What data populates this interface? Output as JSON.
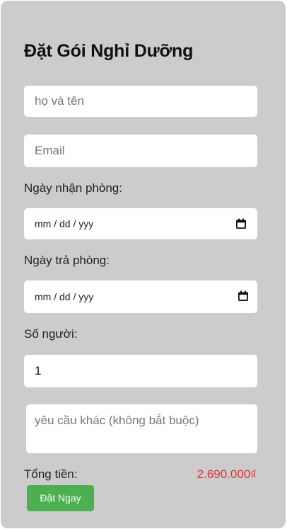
{
  "form": {
    "title": "Đặt Gói Nghỉ Dưỡng",
    "name_placeholder": "họ và tên",
    "email_placeholder": "Email",
    "checkin_label": "Ngày nhận phòng:",
    "checkin_placeholder": "mm / dd / yyy",
    "checkout_label": "Ngày trả phòng:",
    "checkout_placeholder": "mm / dd / yyy",
    "guests_label": "Số người:",
    "guests_value": "1",
    "notes_placeholder": "yêu cầu khác (không bắt buộc)",
    "total_label": "Tổng tiền:",
    "total_value": "2.690.000₫",
    "submit_label": "Đặt Ngay"
  },
  "colors": {
    "card_background": "#cccccc",
    "total_value": "#e23232",
    "submit_button": "#4caf50"
  },
  "icons": {
    "checkin_picker": "calendar-icon",
    "checkout_picker": "calendar-icon"
  }
}
